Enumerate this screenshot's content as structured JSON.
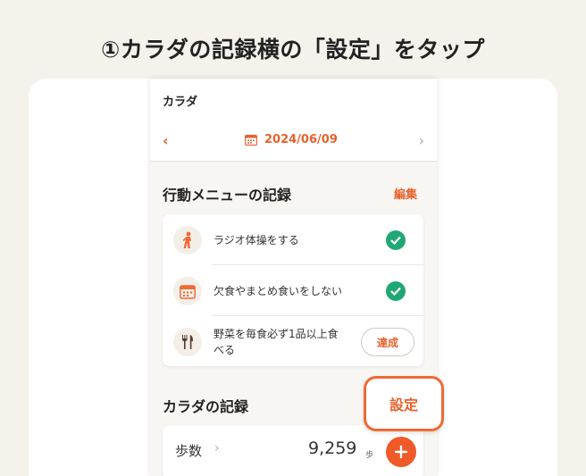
{
  "headline": "①カラダの記録横の「設定」をタップ",
  "app": {
    "title": "カラダ",
    "date": "2024/06/09",
    "prev_icon": "chevron-left-icon",
    "next_icon": "chevron-right-icon",
    "calendar_icon": "calendar-icon"
  },
  "action_menu": {
    "title": "行動メニューの記録",
    "edit_label": "編集",
    "items": [
      {
        "label": "ラジオ体操をする",
        "icon": "walking-person-icon",
        "status": "done"
      },
      {
        "label": "欠食やまとめ食いをしない",
        "icon": "calendar-icon",
        "status": "done"
      },
      {
        "label_line1": "野菜を毎食必ず1品以上食",
        "label_line2": "べる",
        "icon": "fork-knife-icon",
        "status": "pending",
        "button_label": "達成"
      }
    ]
  },
  "body_record": {
    "title": "カラダの記録",
    "settings_label": "設定",
    "steps": {
      "label": "歩数",
      "value": "9,259",
      "unit": "歩"
    }
  },
  "colors": {
    "accent": "#e8622c",
    "check": "#1fa774",
    "background": "#f5f2ec"
  }
}
